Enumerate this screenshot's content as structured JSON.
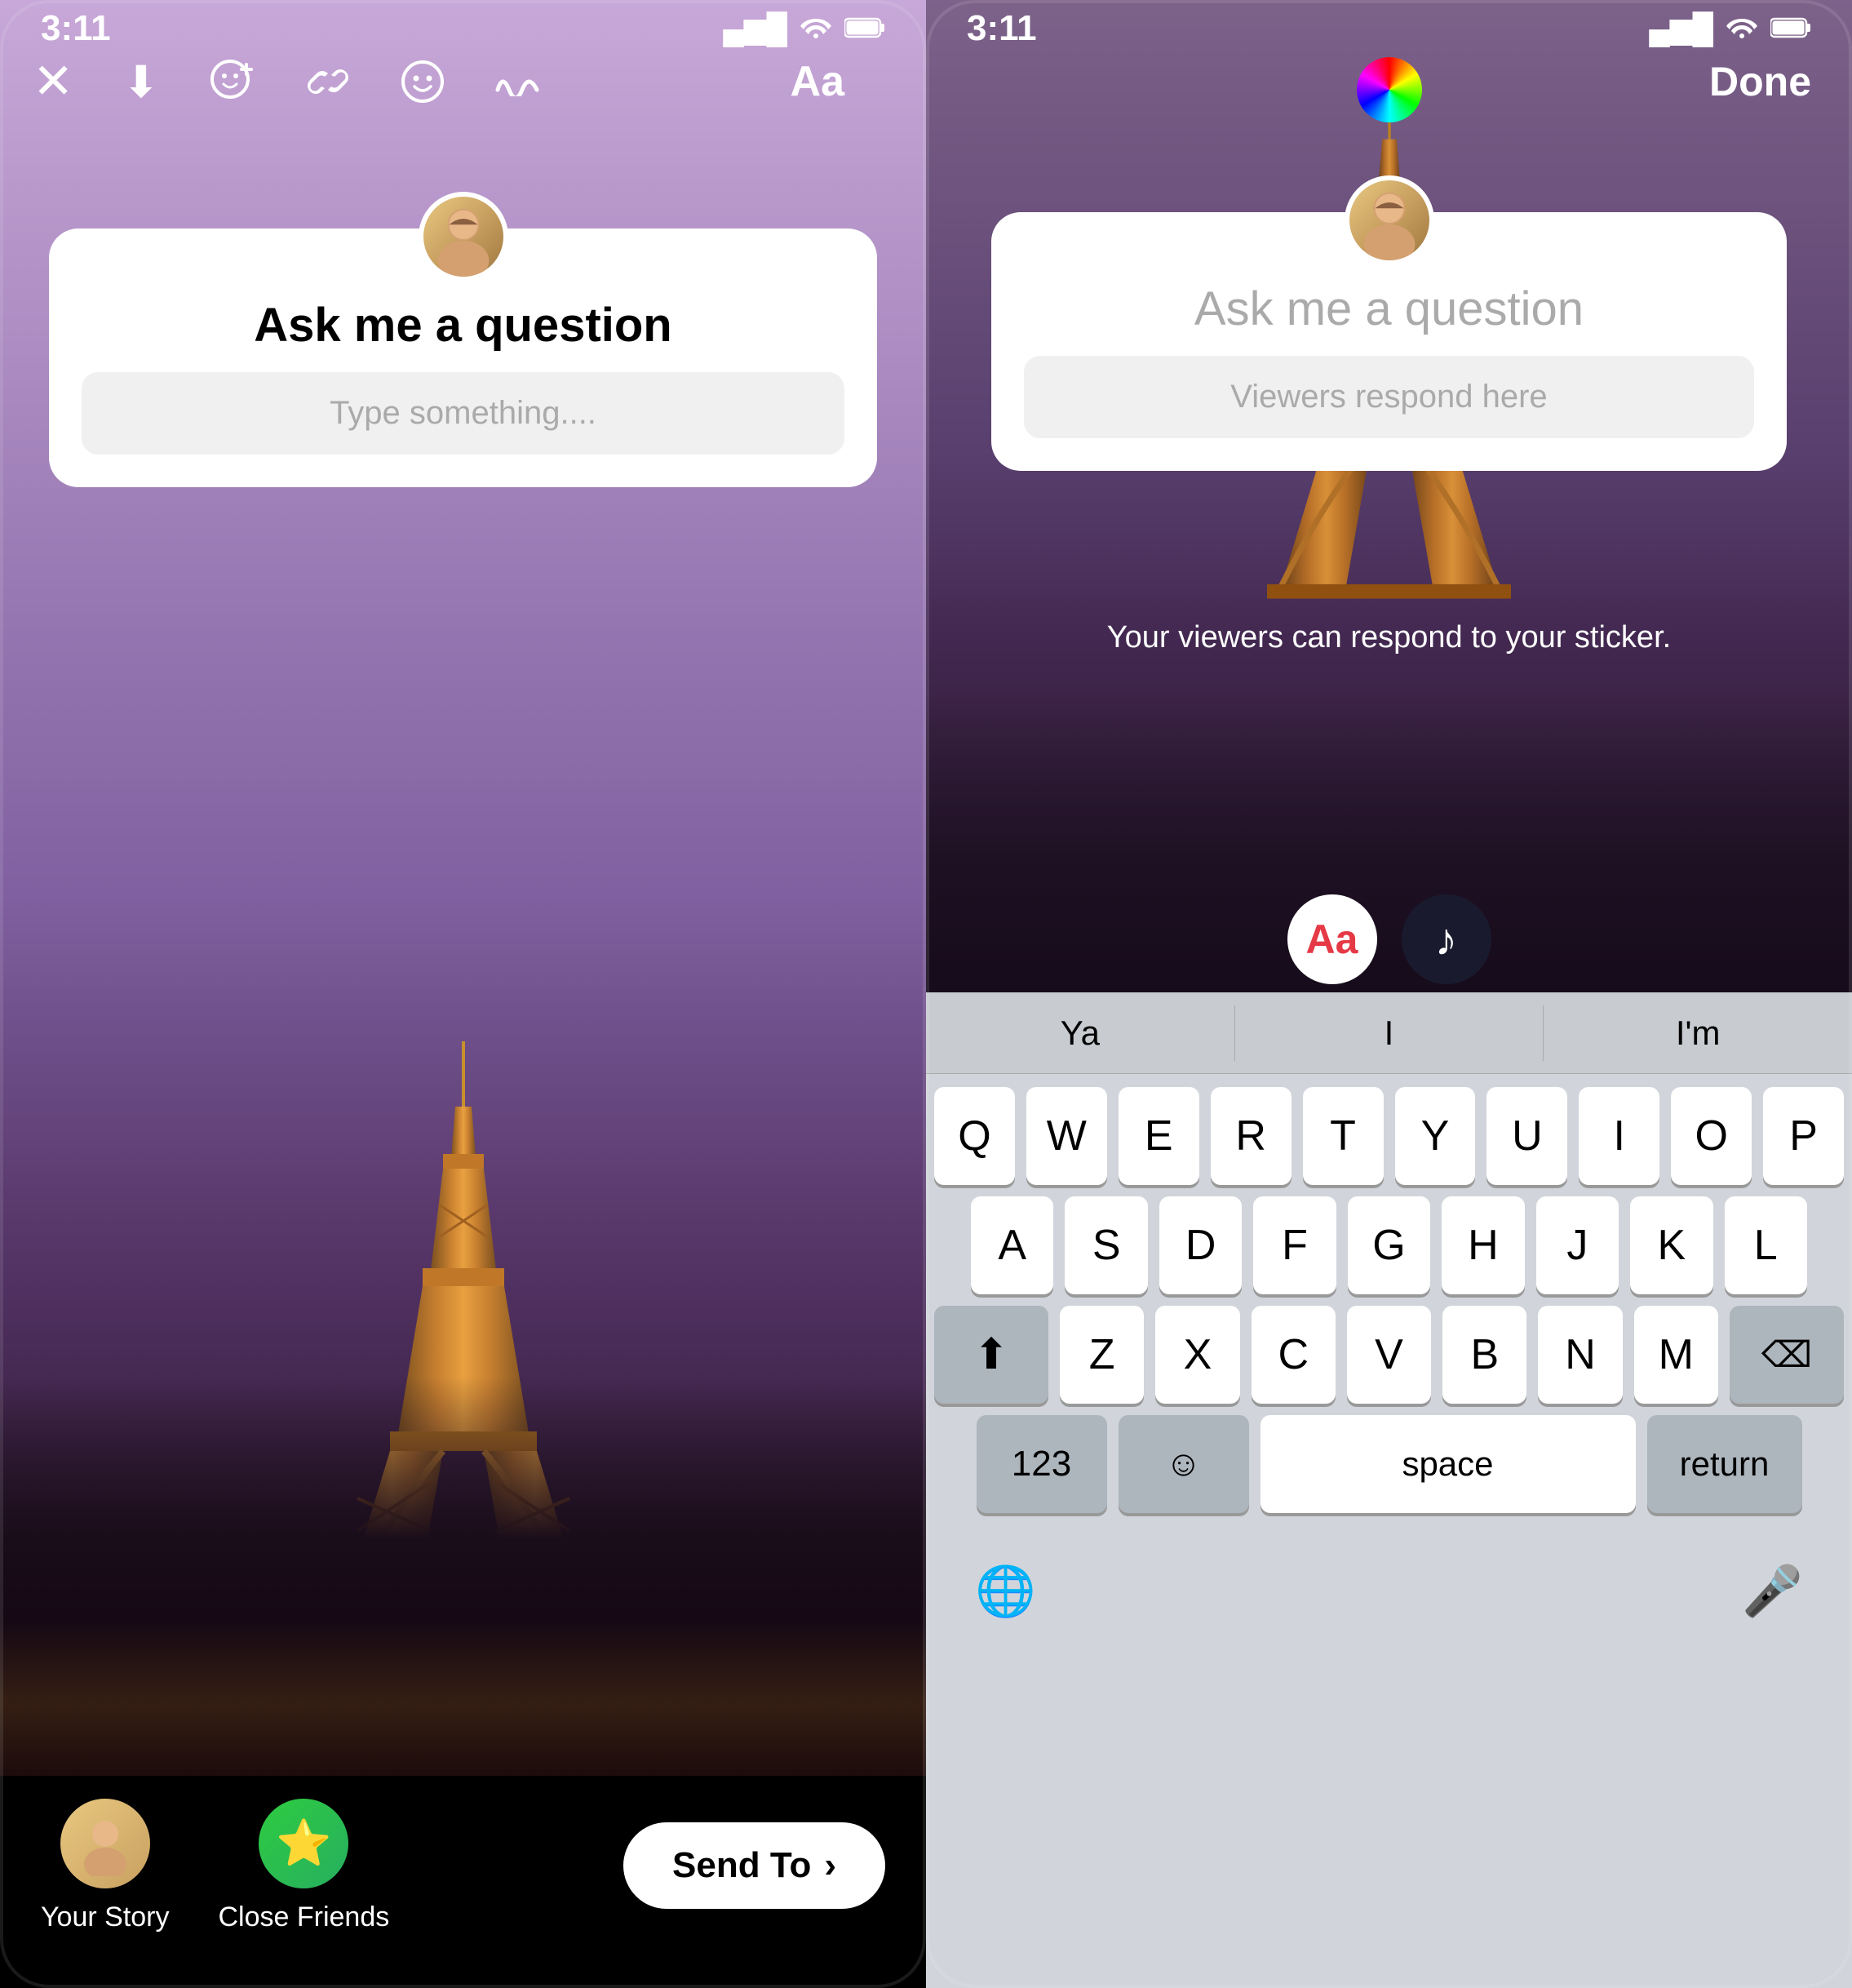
{
  "left_phone": {
    "status_bar": {
      "time": "3:11",
      "signal_bars": "▄▆█",
      "wifi": "WiFi",
      "battery": "Battery"
    },
    "toolbar": {
      "close_icon": "×",
      "download_icon": "⬇",
      "emoji_plus_icon": "😊+",
      "link_icon": "🔗",
      "sticker_icon": "🙂",
      "squiggle_icon": "~",
      "text_icon": "Aa"
    },
    "sticker": {
      "title": "Ask me a question",
      "placeholder": "Type something...."
    },
    "bottom": {
      "your_story_label": "Your Story",
      "close_friends_label": "Close Friends",
      "send_to_label": "Send To",
      "send_arrow": "›"
    }
  },
  "right_phone": {
    "status_bar": {
      "time": "3:11",
      "signal_bars": "▄▆█",
      "wifi": "WiFi",
      "battery": "Battery"
    },
    "toolbar": {
      "done_label": "Done"
    },
    "sticker": {
      "title": "Ask me a question",
      "placeholder": "Viewers respond here"
    },
    "viewer_text": "Your viewers can respond to your sticker.",
    "text_tools": {
      "text_btn": "Aa",
      "music_btn": "♪"
    },
    "keyboard": {
      "predictive": [
        "Ya",
        "I",
        "I'm"
      ],
      "row1": [
        "Q",
        "W",
        "E",
        "R",
        "T",
        "Y",
        "U",
        "I",
        "O",
        "P"
      ],
      "row2": [
        "A",
        "S",
        "D",
        "F",
        "G",
        "H",
        "J",
        "K",
        "L"
      ],
      "row3": [
        "Z",
        "X",
        "C",
        "V",
        "B",
        "N",
        "M"
      ],
      "bottom": {
        "num_key": "123",
        "emoji_key": "☺",
        "space_key": "space",
        "return_key": "return",
        "globe_icon": "🌐",
        "mic_icon": "🎤"
      }
    }
  }
}
